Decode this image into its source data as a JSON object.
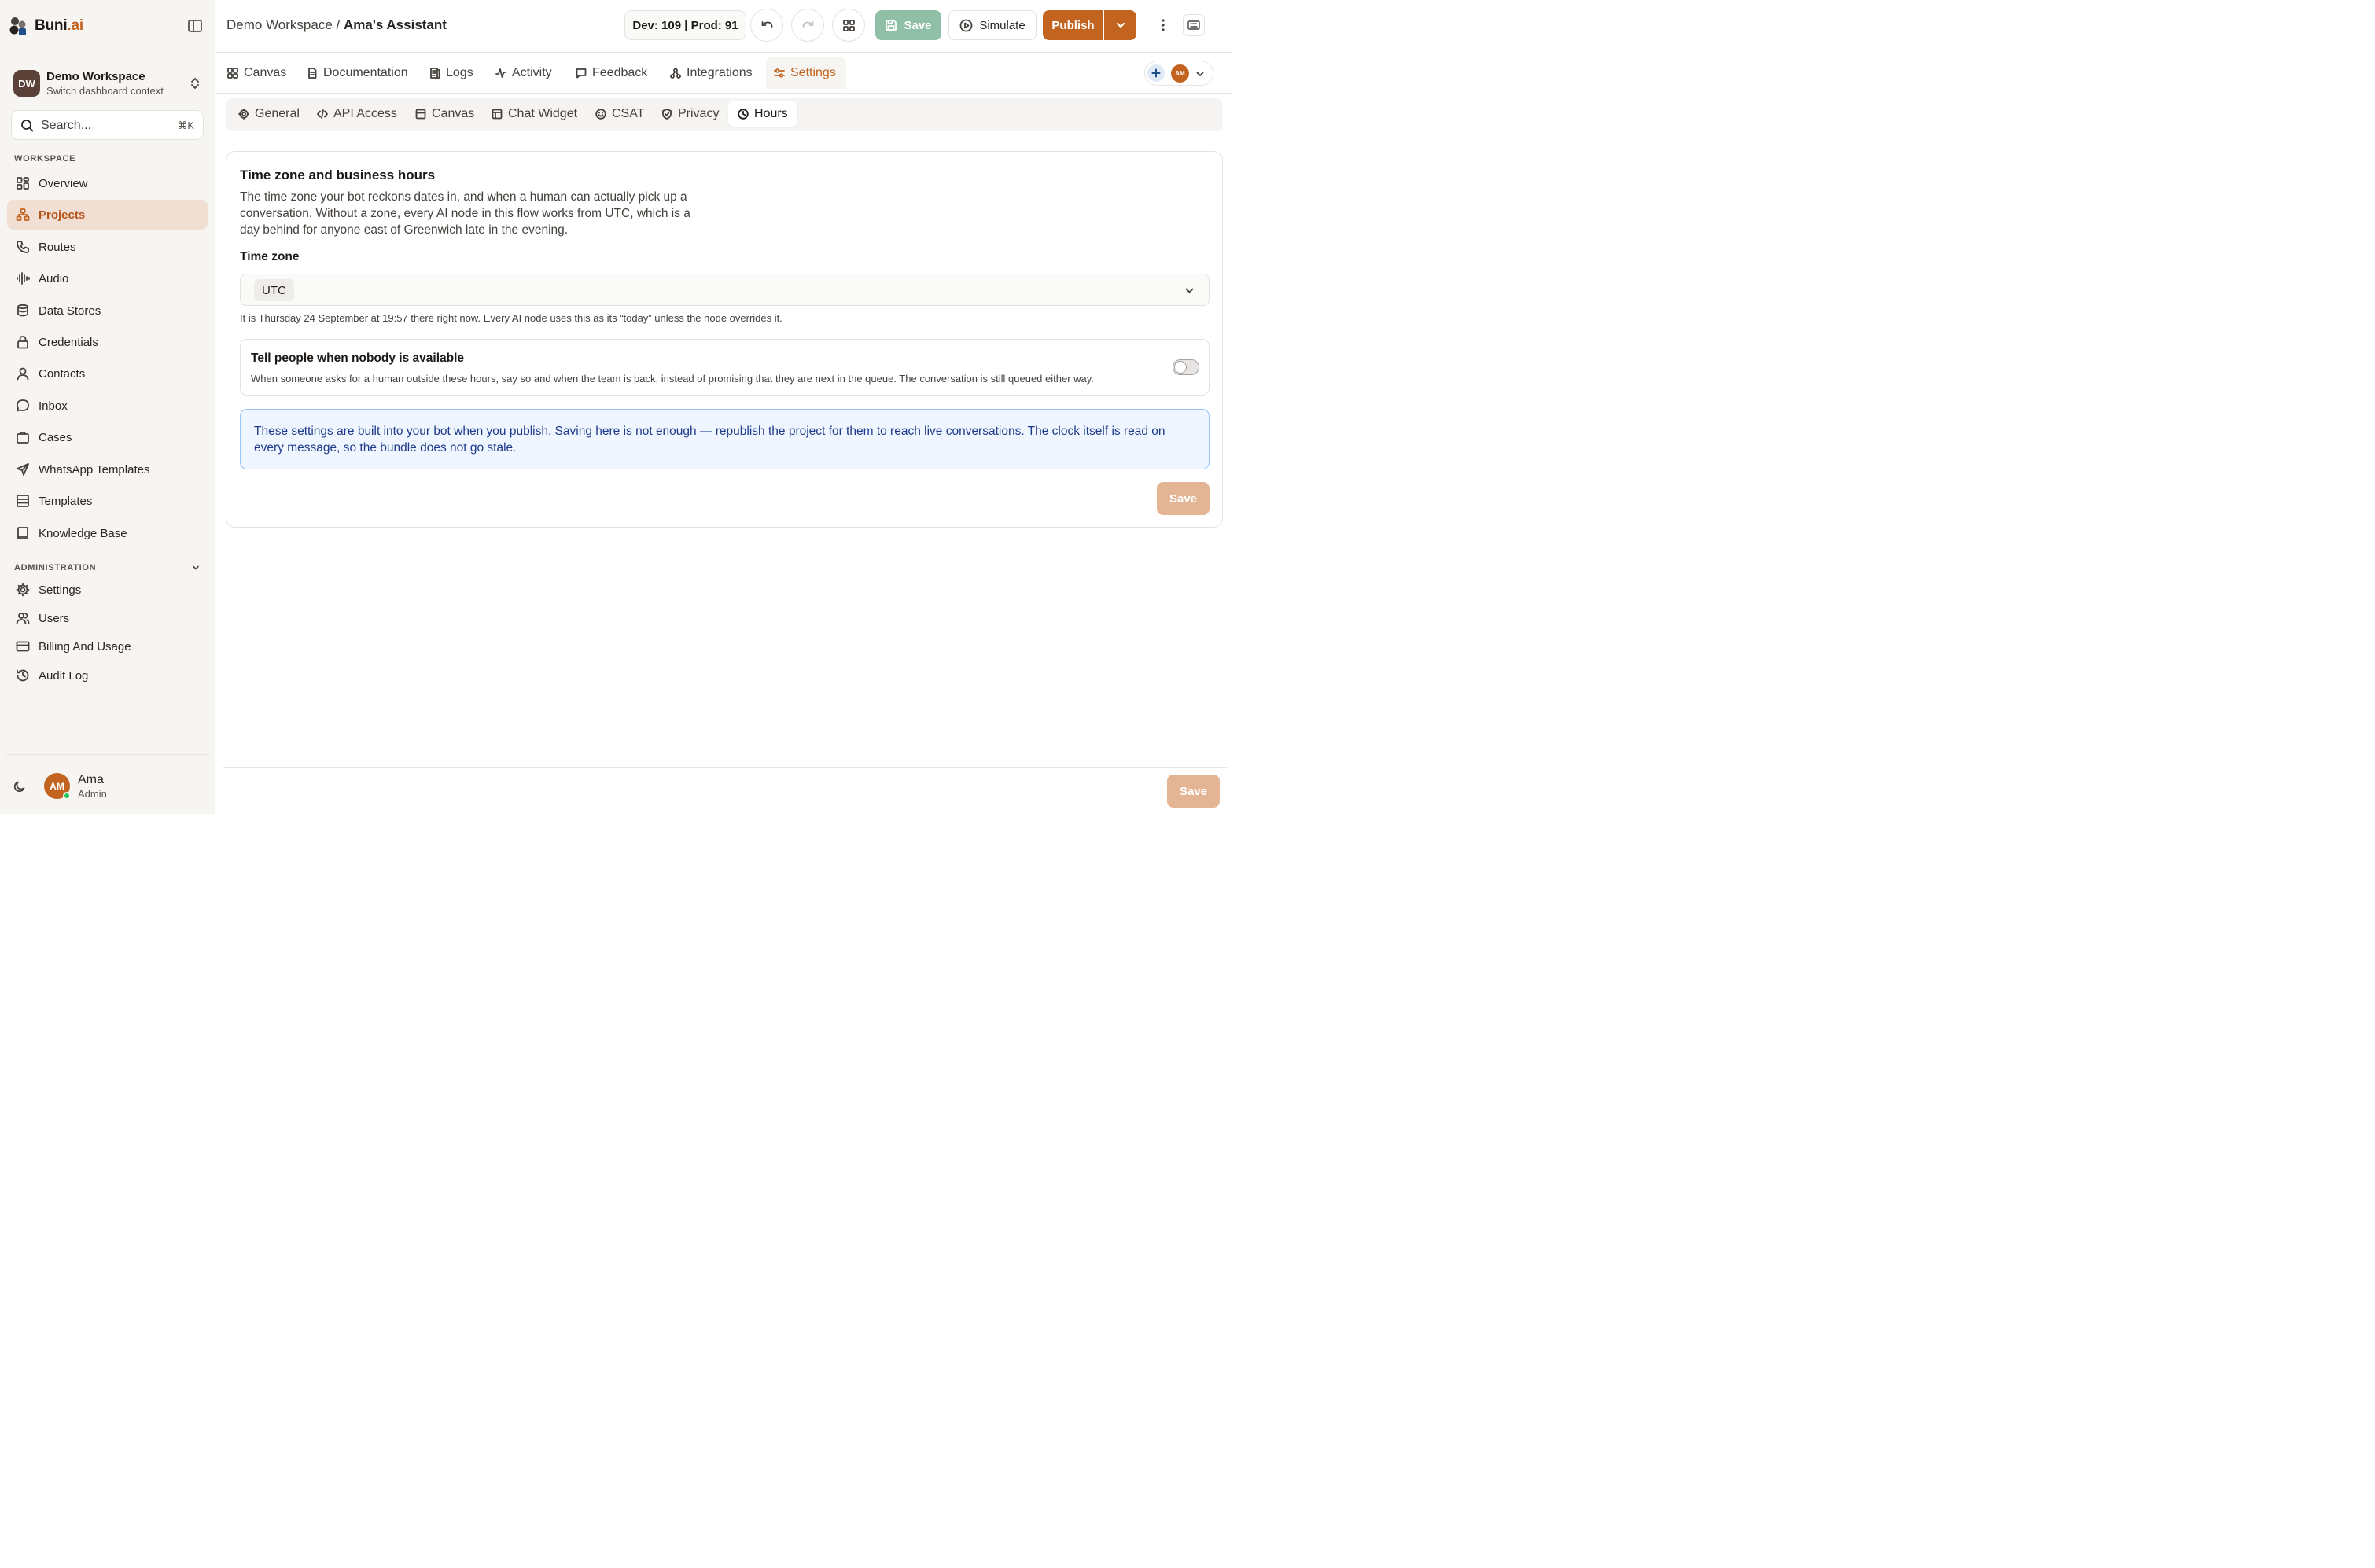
{
  "brand": {
    "name": "Buni",
    "suffix": ".ai"
  },
  "workspace": {
    "initials": "DW",
    "name": "Demo Workspace",
    "subtitle": "Switch dashboard context"
  },
  "search": {
    "placeholder": "Search...",
    "shortcut": "⌘K"
  },
  "sidebar": {
    "workspace_label": "WORKSPACE",
    "workspace_items": [
      {
        "label": "Overview",
        "icon": "grid-icon"
      },
      {
        "label": "Projects",
        "icon": "projects-icon",
        "active": true
      },
      {
        "label": "Routes",
        "icon": "phone-icon"
      },
      {
        "label": "Audio",
        "icon": "audio-wave-icon"
      },
      {
        "label": "Data Stores",
        "icon": "database-icon"
      },
      {
        "label": "Credentials",
        "icon": "lock-icon"
      },
      {
        "label": "Contacts",
        "icon": "user-icon"
      },
      {
        "label": "Inbox",
        "icon": "chat-bubble-icon"
      },
      {
        "label": "Cases",
        "icon": "briefcase-icon"
      },
      {
        "label": "WhatsApp Templates",
        "icon": "send-icon"
      },
      {
        "label": "Templates",
        "icon": "layout-icon"
      },
      {
        "label": "Knowledge Base",
        "icon": "book-icon"
      }
    ],
    "admin_label": "ADMINISTRATION",
    "admin_items": [
      {
        "label": "Settings",
        "icon": "gear-icon"
      },
      {
        "label": "Users",
        "icon": "users-icon"
      },
      {
        "label": "Billing And Usage",
        "icon": "credit-card-icon"
      },
      {
        "label": "Audit Log",
        "icon": "history-icon"
      }
    ]
  },
  "user": {
    "initials": "AM",
    "name": "Ama",
    "role": "Admin"
  },
  "topbar": {
    "breadcrumb_workspace": "Demo Workspace",
    "breadcrumb_sep": " / ",
    "breadcrumb_current": "Ama's Assistant",
    "versions": "Dev: 109 | Prod: 91",
    "save_label": "Save",
    "simulate_label": "Simulate",
    "publish_label": "Publish"
  },
  "main_tabs": [
    {
      "label": "Canvas",
      "icon": "canvas-icon"
    },
    {
      "label": "Documentation",
      "icon": "document-icon"
    },
    {
      "label": "Logs",
      "icon": "logs-icon"
    },
    {
      "label": "Activity",
      "icon": "activity-icon"
    },
    {
      "label": "Feedback",
      "icon": "feedback-icon"
    },
    {
      "label": "Integrations",
      "icon": "integrations-icon"
    },
    {
      "label": "Settings",
      "icon": "settings-sliders-icon",
      "active": true
    }
  ],
  "presence": {
    "initials": "AM"
  },
  "settings_tabs": [
    {
      "label": "General",
      "icon": "gear-icon"
    },
    {
      "label": "API Access",
      "icon": "code-icon"
    },
    {
      "label": "Canvas",
      "icon": "canvas-icon"
    },
    {
      "label": "Chat Widget",
      "icon": "widget-icon"
    },
    {
      "label": "CSAT",
      "icon": "smile-icon"
    },
    {
      "label": "Privacy",
      "icon": "shield-icon"
    },
    {
      "label": "Hours",
      "icon": "clock-icon",
      "active": true
    }
  ],
  "card": {
    "title": "Time zone and business hours",
    "description": "The time zone your bot reckons dates in, and when a human can actually pick up a conversation. Without a zone, every AI node in this flow works from UTC, which is a day behind for anyone east of Greenwich late in the evening.",
    "timezone_label": "Time zone",
    "timezone_value": "UTC",
    "helper": "It is Thursday 24 September at 19:57 there right now. Every AI node uses this as its “today” unless the node overrides it.",
    "toggle_title": "Tell people when nobody is available",
    "toggle_desc": "When someone asks for a human outside these hours, say so and when the team is back, instead of promising that they are next in the queue. The conversation is still queued either way.",
    "toggle_on": false,
    "notice": "These settings are built into your bot when you publish. Saving here is not enough — republish the project for them to reach live conversations. The clock itself is read on every message, so the bundle does not go stale.",
    "save_label": "Save"
  },
  "footer": {
    "save_label": "Save"
  },
  "colors": {
    "accent": "#c2631f",
    "save_green": "#8fbfa6",
    "save_disabled": "#e3b594",
    "notice_bg": "#eff6ff",
    "notice_text": "#1e3a8a"
  }
}
